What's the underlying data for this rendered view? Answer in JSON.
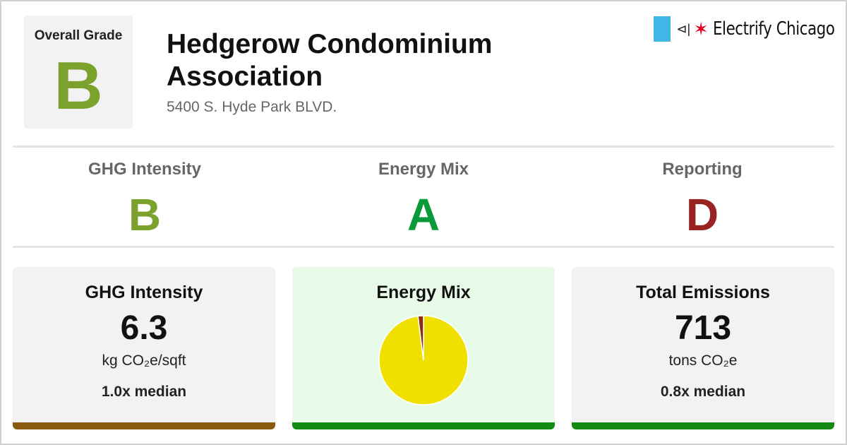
{
  "overall": {
    "label": "Overall Grade",
    "grade": "B",
    "color": "#7aa22c"
  },
  "building": {
    "name": "Hedgerow Condominium Association",
    "address": "5400 S. Hyde Park BLVD."
  },
  "brand": {
    "name": "Electrify Chicago",
    "flag_color": "#41b6e6",
    "plug_glyph": "⊲|",
    "star_glyph": "✶"
  },
  "grades": [
    {
      "label": "GHG Intensity",
      "grade": "B",
      "color": "#7aa22c"
    },
    {
      "label": "Energy Mix",
      "grade": "A",
      "color": "#0a9a3c"
    },
    {
      "label": "Reporting",
      "grade": "D",
      "color": "#992222"
    }
  ],
  "cards": {
    "ghg": {
      "title": "GHG Intensity",
      "value": "6.3",
      "unit": "kg CO₂e/sqft",
      "median": "1.0x median",
      "bar_color": "#8a5a11",
      "bg": "#f2f2f2"
    },
    "mix": {
      "title": "Energy Mix",
      "bg": "#e8fbe8",
      "bar_color": "#138a13"
    },
    "total": {
      "title": "Total Emissions",
      "value": "713",
      "unit": "tons CO₂e",
      "median": "0.8x median",
      "bar_color": "#138a13",
      "bg": "#f2f2f2"
    }
  },
  "chart_data": {
    "type": "pie",
    "slices": [
      {
        "value": 98,
        "color": "#efe000"
      },
      {
        "value": 2,
        "color": "#8b2d0c"
      }
    ]
  }
}
